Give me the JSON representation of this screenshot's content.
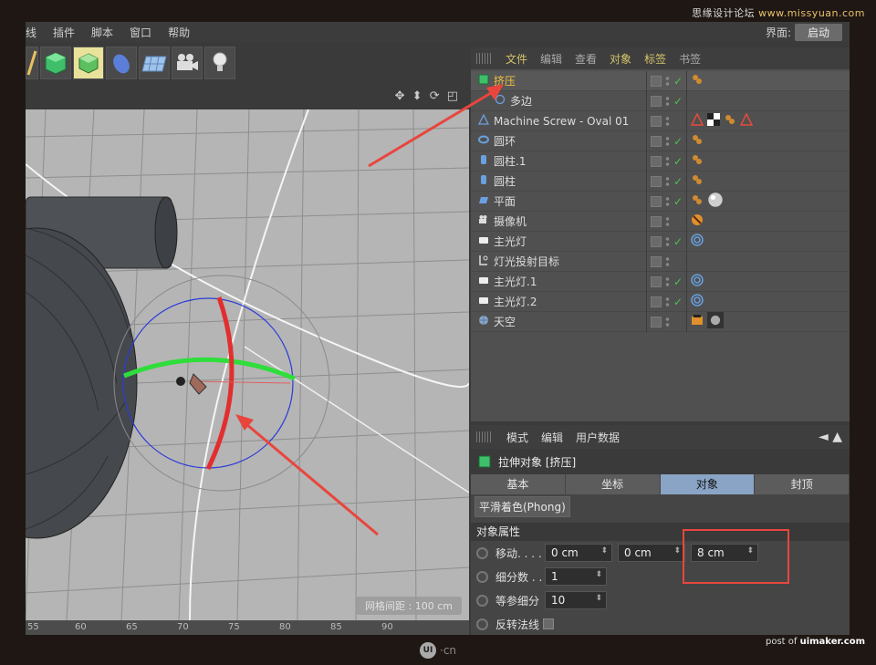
{
  "watermark_top": {
    "prefix": "思缘设计论坛",
    "site": "www.missyuan.com"
  },
  "menubar": {
    "items": [
      "线",
      "插件",
      "脚本",
      "窗口",
      "帮助"
    ],
    "layout_label": "界面:",
    "layout_value": "启动"
  },
  "toolbar": {
    "icons": [
      "pen-icon",
      "cube-icon",
      "subdivision-icon",
      "deformer-icon",
      "floor-icon",
      "camera-icon",
      "light-icon"
    ]
  },
  "viewport": {
    "grid_spacing": "网格间距 : 100 cm",
    "ruler_ticks": [
      "55",
      "60",
      "65",
      "70",
      "75",
      "80",
      "85",
      "90"
    ]
  },
  "object_manager": {
    "menu": [
      "文件",
      "编辑",
      "查看",
      "对象",
      "标签",
      "书签"
    ],
    "objects": [
      {
        "name": "挤压",
        "icon": "extrude-icon",
        "check": true,
        "selected": true,
        "indent": 0,
        "tags": [
          "phong-tag"
        ]
      },
      {
        "name": "多边",
        "icon": "polygon-icon",
        "check": true,
        "selected": false,
        "indent": 1,
        "tags": []
      },
      {
        "name": "Machine Screw - Oval 01",
        "icon": "screw-icon",
        "check": false,
        "selected": false,
        "indent": 0,
        "tags": [
          "warning-tag",
          "checker-tag",
          "phong-tag",
          "warning-tag"
        ]
      },
      {
        "name": "圆环",
        "icon": "torus-icon",
        "check": true,
        "selected": false,
        "indent": 0,
        "tags": [
          "phong-tag"
        ]
      },
      {
        "name": "圆柱.1",
        "icon": "cylinder-icon",
        "check": true,
        "selected": false,
        "indent": 0,
        "tags": [
          "phong-tag"
        ]
      },
      {
        "name": "圆柱",
        "icon": "cylinder-icon",
        "check": true,
        "selected": false,
        "indent": 0,
        "tags": [
          "phong-tag"
        ]
      },
      {
        "name": "平面",
        "icon": "plane-icon",
        "check": true,
        "selected": false,
        "indent": 0,
        "tags": [
          "phong-tag",
          "material-tag"
        ]
      },
      {
        "name": "摄像机",
        "icon": "camera-icon",
        "check": false,
        "selected": false,
        "indent": 0,
        "tags": [
          "protection-tag"
        ]
      },
      {
        "name": "主光灯",
        "icon": "light-icon",
        "check": true,
        "selected": false,
        "indent": 0,
        "tags": [
          "target-tag"
        ]
      },
      {
        "name": "灯光投射目标",
        "icon": "null-icon",
        "check": false,
        "selected": false,
        "indent": 0,
        "tags": []
      },
      {
        "name": "主光灯.1",
        "icon": "light-icon",
        "check": true,
        "selected": false,
        "indent": 0,
        "tags": [
          "target-tag"
        ]
      },
      {
        "name": "主光灯.2",
        "icon": "light-icon",
        "check": true,
        "selected": false,
        "indent": 0,
        "tags": [
          "target-tag"
        ]
      },
      {
        "name": "天空",
        "icon": "sky-icon",
        "check": false,
        "selected": false,
        "indent": 0,
        "tags": [
          "compositing-tag",
          "sky-material-tag"
        ]
      }
    ]
  },
  "attribute_manager": {
    "menu": [
      "模式",
      "编辑",
      "用户数据"
    ],
    "title": "拉伸对象 [挤压]",
    "tabs": [
      "基本",
      "坐标",
      "对象",
      "封顶"
    ],
    "active_tab": "对象",
    "phong_button": "平滑着色(Phong)",
    "section": "对象属性",
    "props": {
      "move_label": "移动. . . .",
      "move_values": [
        "0 cm",
        "0 cm",
        "8 cm"
      ],
      "subdiv_label": "细分数 . .",
      "subdiv_value": "1",
      "iso_label": "等参细分",
      "iso_value": "10",
      "flip_label": "反转法线"
    }
  },
  "footer": {
    "logo_text": "UI",
    "logo_suffix": "·cn",
    "credit_prefix": "post of",
    "credit_site": "uimaker.com"
  },
  "colors": {
    "accent_orange": "#f0c040",
    "tab_active": "#8aa4c6",
    "annotation_red": "#e8463d",
    "check_green": "#4ec04e"
  }
}
